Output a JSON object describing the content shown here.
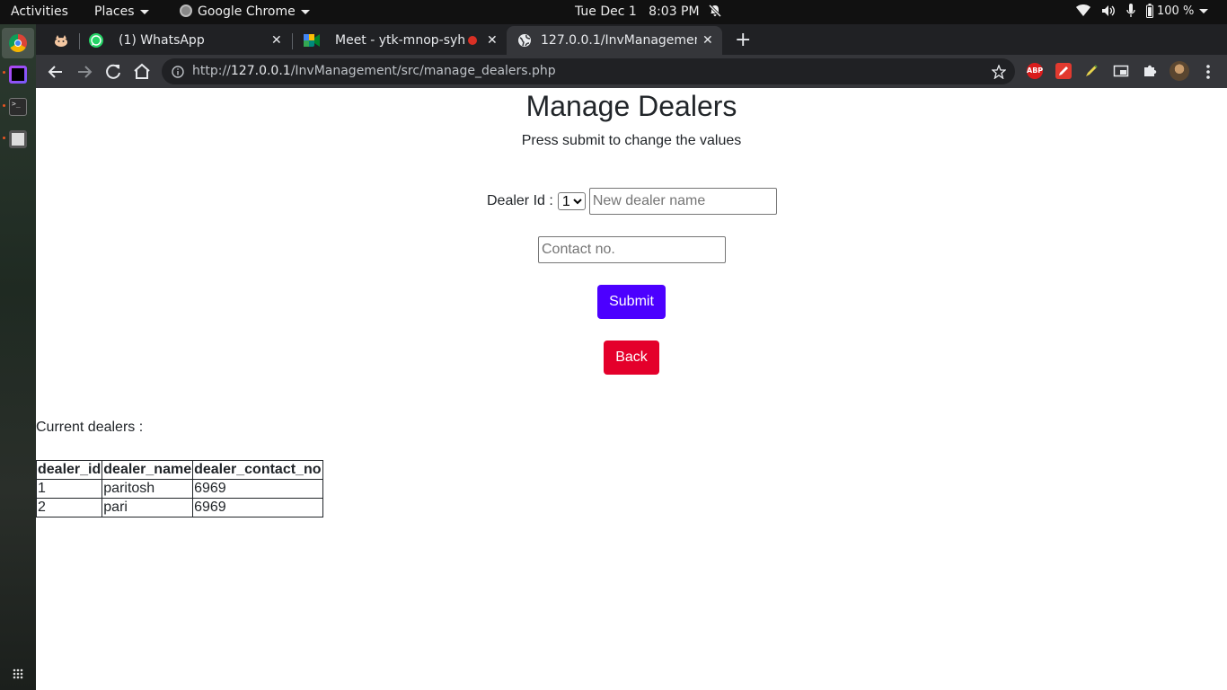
{
  "topbar": {
    "activities": "Activities",
    "places": "Places",
    "app": "Google Chrome",
    "clock": "Tue Dec 1   8:03 PM",
    "battery": "100 %"
  },
  "tabs": [
    {
      "title": "",
      "icon": "pinned-app-icon"
    },
    {
      "title": "(1) WhatsApp",
      "icon": "whatsapp-icon"
    },
    {
      "title": "Meet - ytk-mnop-syh",
      "icon": "google-meet-icon"
    },
    {
      "title": "127.0.0.1/InvManagement/src/manage_dealers.php",
      "icon": "globe-icon",
      "active": true
    }
  ],
  "address_bar": {
    "scheme": "http://",
    "host": "127.0.0.1",
    "path": "/InvManagement/src/manage_dealers.php"
  },
  "extensions": {
    "abp": "ABP"
  },
  "page": {
    "title": "Manage Dealers",
    "subtitle": "Press submit to change the values",
    "dealer_id_label": "Dealer Id :",
    "dealer_id_selected": "1",
    "dealer_name_placeholder": "New dealer name",
    "contact_placeholder": "Contact no.",
    "submit_label": "Submit",
    "back_label": "Back",
    "current_dealers_label": "Current dealers :",
    "table": {
      "headers": [
        "dealer_id",
        "dealer_name",
        "dealer_contact_no"
      ],
      "rows": [
        [
          "1",
          "paritosh",
          "6969"
        ],
        [
          "2",
          "pari",
          "6969"
        ]
      ]
    }
  },
  "colors": {
    "submit": "#4c00ff",
    "back": "#e4002b"
  }
}
